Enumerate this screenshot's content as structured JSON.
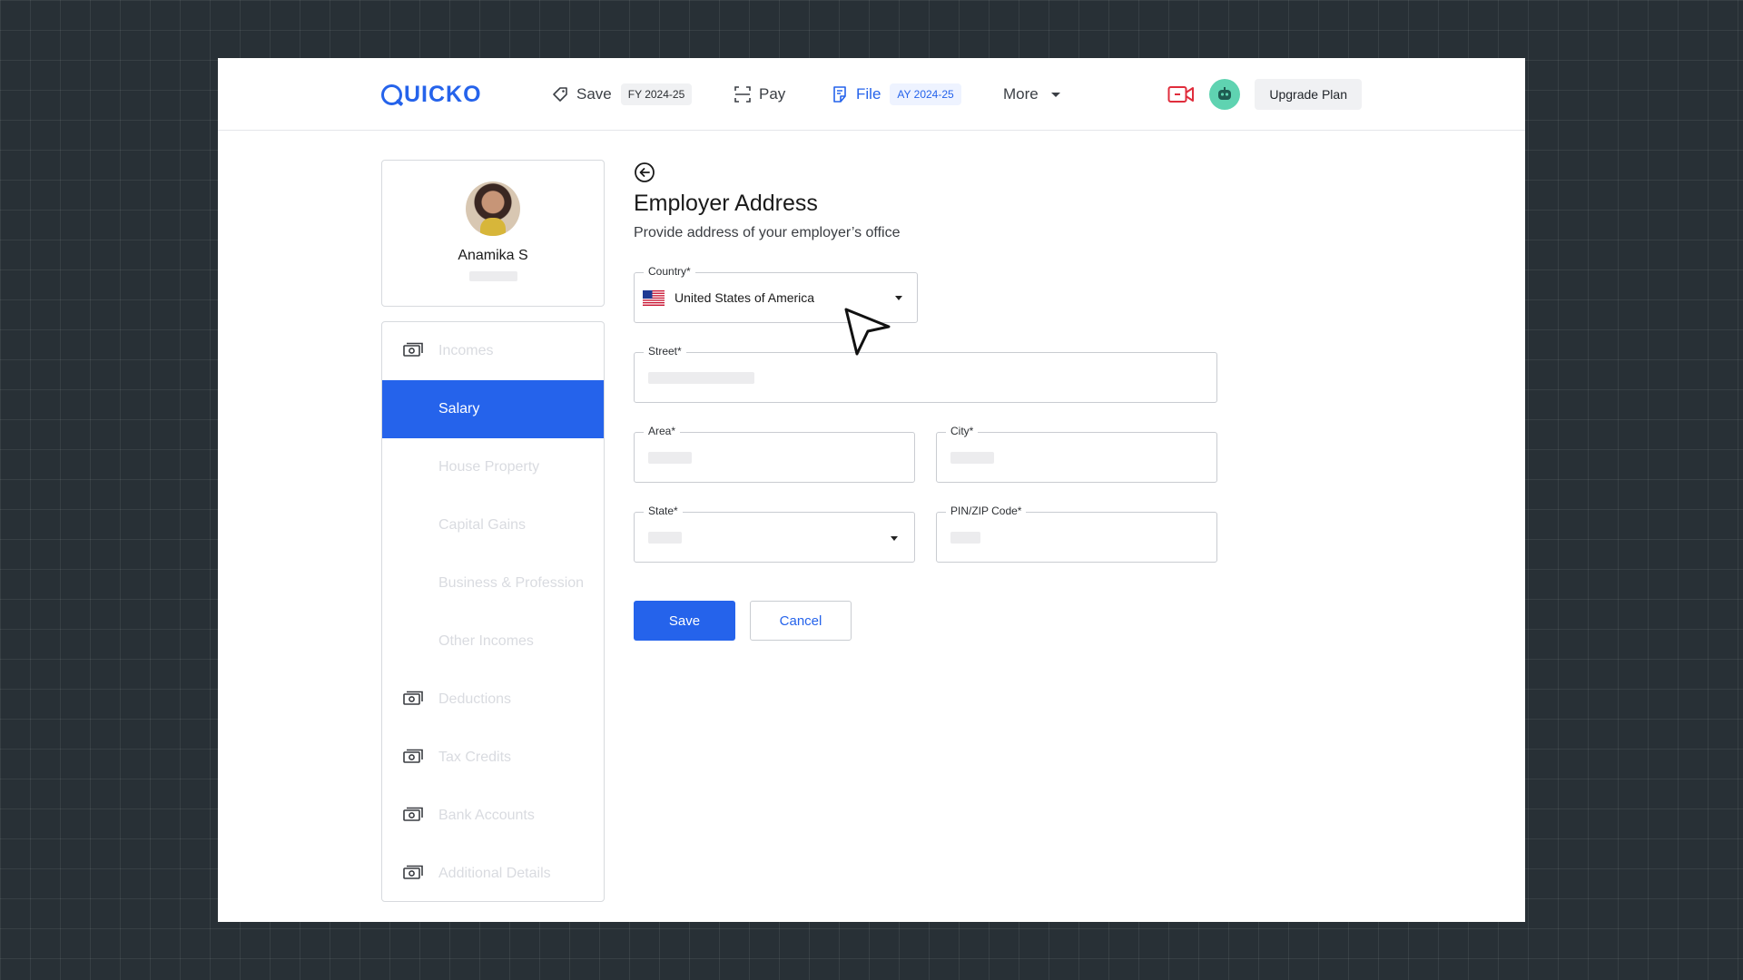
{
  "header": {
    "logo_text": "UICKO",
    "nav": [
      {
        "label": "Save",
        "badge": "FY 2024-25",
        "icon": "tag-icon"
      },
      {
        "label": "Pay",
        "icon": "scan-icon"
      },
      {
        "label": "File",
        "badge": "AY 2024-25",
        "icon": "document-icon"
      },
      {
        "label": "More",
        "icon": "chevron-down-icon"
      }
    ],
    "upgrade_label": "Upgrade Plan",
    "accent_color": "#2563eb"
  },
  "profile": {
    "name": "Anamika S"
  },
  "sidebar": {
    "items": [
      {
        "label": "Incomes",
        "icon": "money-icon"
      },
      {
        "label": "Salary",
        "active": true
      },
      {
        "label": "House Property"
      },
      {
        "label": "Capital Gains"
      },
      {
        "label": "Business & Profession"
      },
      {
        "label": "Other Incomes"
      },
      {
        "label": "Deductions",
        "icon": "money-icon"
      },
      {
        "label": "Tax Credits",
        "icon": "money-icon"
      },
      {
        "label": "Bank Accounts",
        "icon": "money-icon"
      },
      {
        "label": "Additional Details",
        "icon": "money-icon"
      }
    ]
  },
  "form": {
    "title": "Employer Address",
    "subtitle": "Provide address of your employer’s office",
    "country": {
      "label": "Country*",
      "value": "United States of America",
      "flag": "us-flag-icon"
    },
    "street": {
      "label": "Street*"
    },
    "area": {
      "label": "Area*"
    },
    "city": {
      "label": "City*"
    },
    "state": {
      "label": "State*"
    },
    "zip": {
      "label": "PIN/ZIP Code*"
    },
    "save_label": "Save",
    "cancel_label": "Cancel"
  }
}
